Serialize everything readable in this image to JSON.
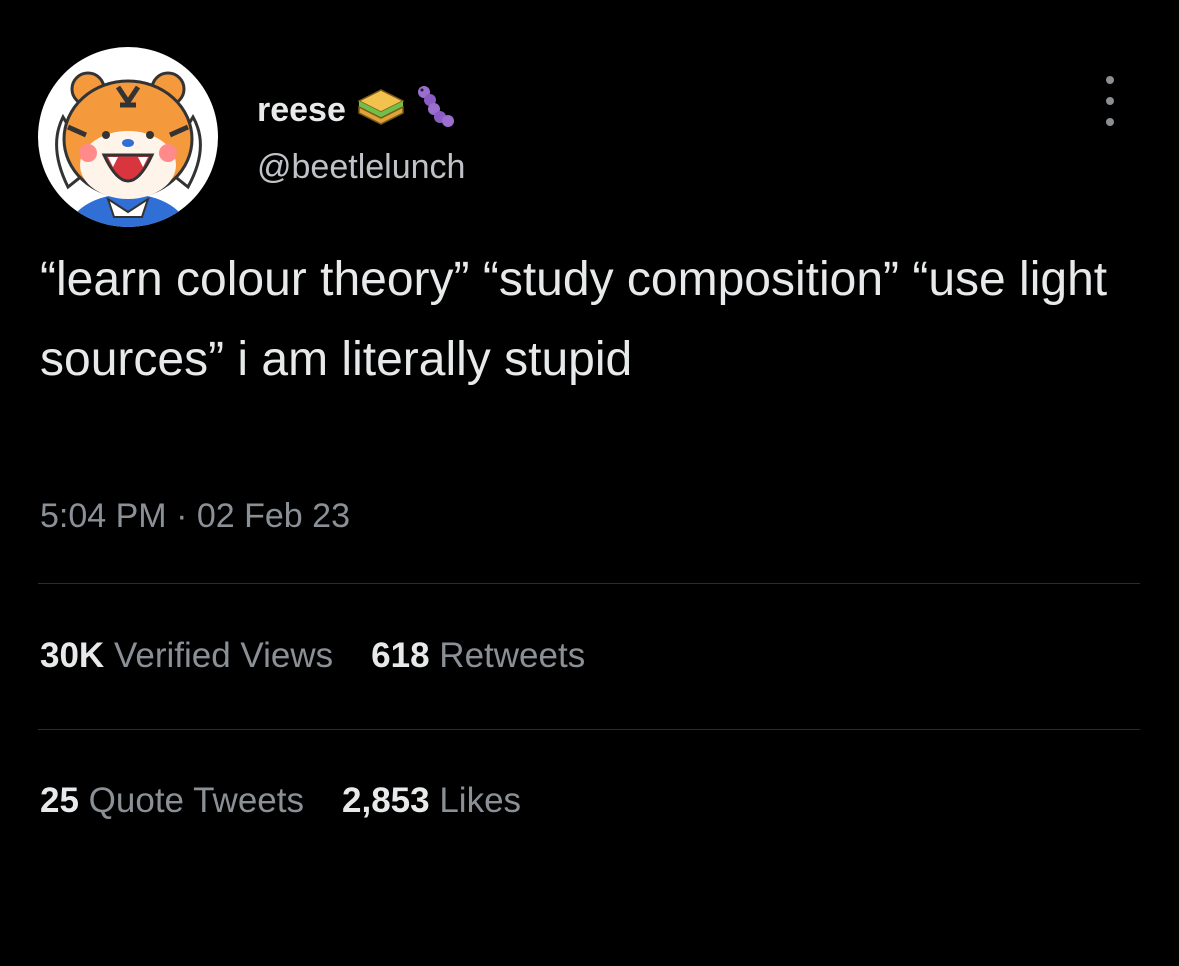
{
  "tweet": {
    "display_name": "reese",
    "name_emojis": [
      "sandwich-icon",
      "caterpillar-icon"
    ],
    "handle": "@beetlelunch",
    "text": "“learn colour theory” “study composition” “use light sources” i am literally stupid",
    "time": "5:04 PM",
    "separator": "·",
    "date": "02 Feb 23"
  },
  "stats": {
    "views_count": "30K",
    "views_label": "Verified Views",
    "retweets_count": "618",
    "retweets_label": "Retweets",
    "quotes_count": "25",
    "quotes_label": "Quote Tweets",
    "likes_count": "2,853",
    "likes_label": "Likes"
  },
  "colors": {
    "background": "#000000",
    "primary_text": "#e7e9ea",
    "secondary_text": "#8b9096"
  }
}
